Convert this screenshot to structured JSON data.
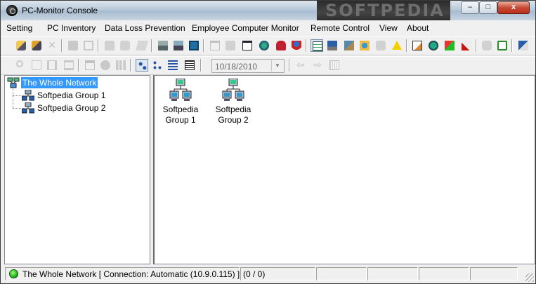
{
  "window": {
    "title": "PC-Monitor Console",
    "watermark": "SOFTPEDIA",
    "controls": {
      "minimize": "–",
      "maximize": "□",
      "close": "x"
    }
  },
  "menu": [
    "Setting",
    "PC Inventory",
    "Data Loss Prevention",
    "Employee Computer Monitor",
    "Remote Control",
    "View",
    "About"
  ],
  "toolbar": {
    "date_value": "10/18/2010",
    "date_dropdown_glyph": "▼"
  },
  "tree": {
    "root": "The Whole Network",
    "children": [
      "Softpedia Group 1",
      "Softpedia Group 2"
    ]
  },
  "content": {
    "items": [
      {
        "line1": "Softpedia",
        "line2": "Group 1"
      },
      {
        "line1": "Softpedia",
        "line2": "Group 2"
      }
    ]
  },
  "status": {
    "connection": "The Whole Network [ Connection: Automatic (10.9.0.115) ]",
    "count": "(0 / 0)",
    "indicator_color": "#1aa314"
  },
  "colors": {
    "selection": "#3399ff"
  }
}
